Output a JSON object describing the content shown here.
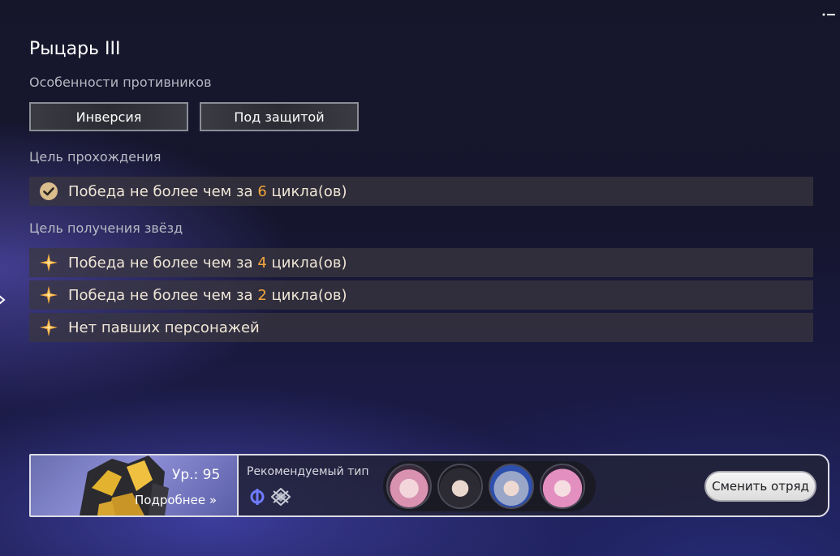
{
  "stage": {
    "title": "Рыцарь III"
  },
  "enemy_features": {
    "label": "Особенности противников",
    "items": [
      "Инверсия",
      "Под защитой"
    ]
  },
  "clear_goal": {
    "label": "Цель прохождения",
    "text_before": "Победа не более чем за ",
    "value": "6",
    "text_after": " цикла(ов)"
  },
  "star_goals": {
    "label": "Цель получения звёзд",
    "items": [
      {
        "text_before": "Победа не более чем за ",
        "value": "4",
        "text_after": " цикла(ов)"
      },
      {
        "text_before": "Победа не более чем за ",
        "value": "2",
        "text_after": " цикла(ов)"
      },
      {
        "text_before": "Нет павших персонажей",
        "value": "",
        "text_after": ""
      }
    ]
  },
  "boss": {
    "level_text": "Ур.: 95",
    "details_label": "Подробнее"
  },
  "recommended": {
    "label": "Рекомендуемый тип",
    "path_icons": [
      "erudition-icon",
      "preservation-icon"
    ]
  },
  "team": {
    "avatars": [
      "character-avatar-1",
      "character-avatar-2",
      "character-avatar-3",
      "character-avatar-4"
    ],
    "change_label": "Сменить отряд"
  },
  "colors": {
    "highlight": "#f4a53b",
    "star": "#ffb13a",
    "check_bg": "#d9bd8c"
  }
}
